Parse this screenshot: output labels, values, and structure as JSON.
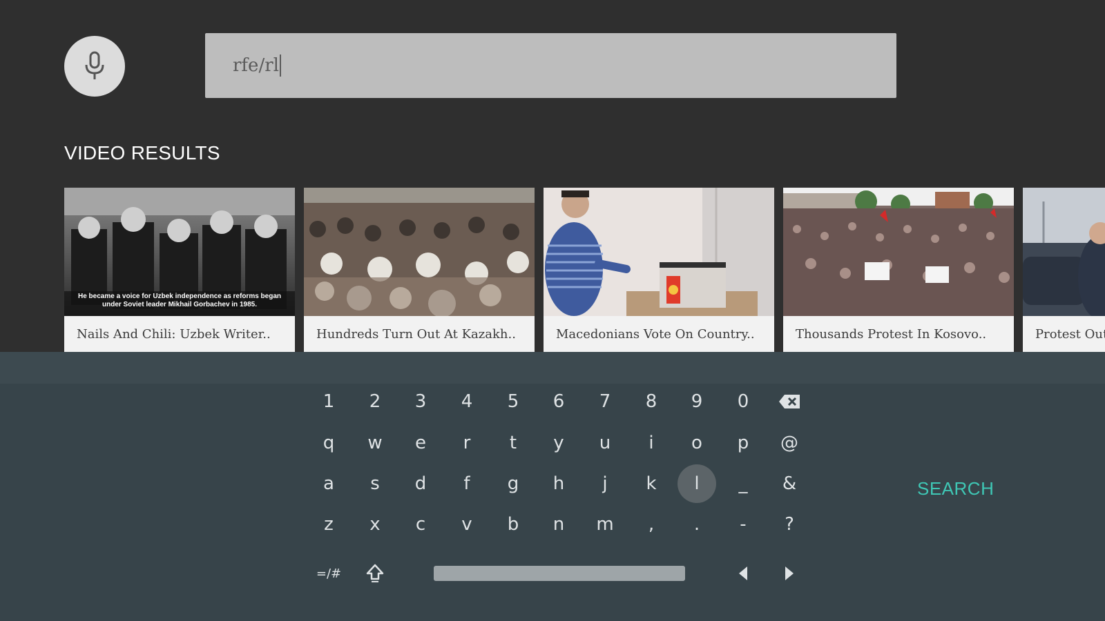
{
  "search": {
    "query": "rfe/rl",
    "mic_icon": "microphone-icon"
  },
  "results": {
    "title": "VIDEO RESULTS",
    "thumbnail_overlay": "He became a voice for Uzbek independence as reforms began under Soviet leader Mikhail Gorbachev in 1985.",
    "items": [
      {
        "title": "Nails And Chili: Uzbek Writer.."
      },
      {
        "title": "Hundreds Turn Out At Kazakh.."
      },
      {
        "title": "Macedonians Vote On Country.."
      },
      {
        "title": "Thousands Protest In Kosovo.."
      },
      {
        "title": "Protest Out"
      }
    ]
  },
  "keyboard": {
    "rows": [
      [
        "1",
        "2",
        "3",
        "4",
        "5",
        "6",
        "7",
        "8",
        "9",
        "0"
      ],
      [
        "q",
        "w",
        "e",
        "r",
        "t",
        "y",
        "u",
        "i",
        "o",
        "p",
        "@"
      ],
      [
        "a",
        "s",
        "d",
        "f",
        "g",
        "h",
        "j",
        "k",
        "l",
        "_",
        "&"
      ],
      [
        "z",
        "x",
        "c",
        "v",
        "b",
        "n",
        "m",
        ",",
        ".",
        "-",
        "?"
      ]
    ],
    "symbols_label": "=/#",
    "selected_key": "l",
    "action_label": "SEARCH",
    "colors": {
      "accent": "#3fc7b5",
      "background": "#37444a"
    }
  }
}
